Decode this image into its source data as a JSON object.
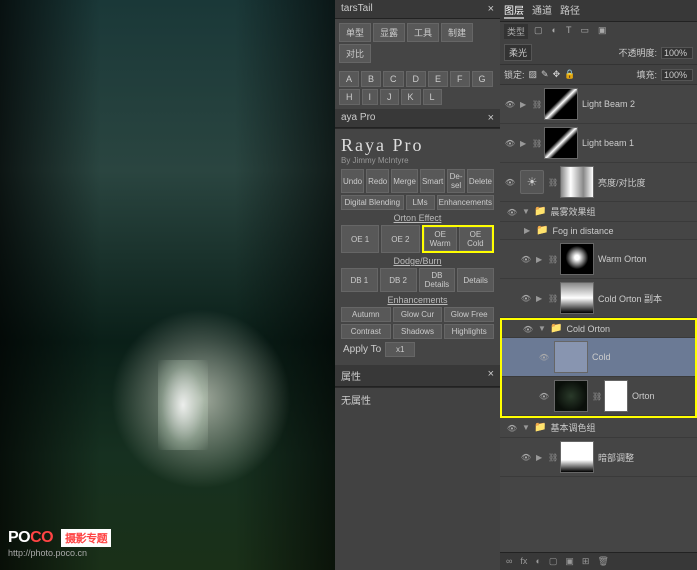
{
  "watermark": {
    "logo_prefix": "PO",
    "logo_suffix": "CO",
    "logo_cn": "摄影专题",
    "url": "http://photo.poco.cn"
  },
  "starstail": {
    "title": "tarsTail",
    "buttons": [
      "单型",
      "显露",
      "工具",
      "制建",
      "对比"
    ],
    "smallbtns": [
      "A",
      "B",
      "C",
      "D",
      "E",
      "F",
      "G",
      "H",
      "I",
      "J",
      "K",
      "L"
    ]
  },
  "raya": {
    "title": "Raya Pro",
    "subtitle": "By Jimmy McIntyre",
    "hdr": "aya Pro",
    "row1": [
      "Undo",
      "Redo",
      "Merge",
      "Smart",
      "De-sel",
      "Delete"
    ],
    "row2": [
      "Digital Blending",
      "LMs",
      "Enhancements"
    ],
    "orton_label": "Orton Effect",
    "orton": [
      "OE 1",
      "OE 2",
      "OE Warm",
      "OE Cold"
    ],
    "dodge_label": "Dodge/Burn",
    "dodge": [
      "DB 1",
      "DB 2",
      "DB Details",
      "Details"
    ],
    "enh_label": "Enhancements",
    "enh1": [
      "Autumn",
      "Glow Cur",
      "Glow Free"
    ],
    "enh2": [
      "Contrast",
      "Shadows",
      "Highlights"
    ],
    "apply": "Apply To",
    "apply_val": "x1"
  },
  "attrib": {
    "tab": "属性",
    "text": "无属性"
  },
  "layers_panel": {
    "tabs": [
      "图层",
      "通道",
      "路径"
    ],
    "kind": "类型",
    "blend": "柔光",
    "opacity_lbl": "不透明度:",
    "opacity": "100%",
    "lock_lbl": "锁定:",
    "fill_lbl": "填充:",
    "fill": "100%"
  },
  "layers": {
    "l1": "Light Beam 2",
    "l2": "Light beam 1",
    "l3": "亮度/对比度",
    "g1": "晨雾效果组",
    "fog": "Fog in distance",
    "l4": "Warm Orton",
    "l5": "Cold Orton 副本",
    "g2": "Cold Orton",
    "l6": "Cold",
    "l7": "Orton",
    "g3": "基本调色组",
    "l8": "暗部调整"
  },
  "footer": {
    "icons": [
      "∞",
      "fx",
      "◐",
      "▢",
      "▣",
      "⊞",
      "🗑"
    ]
  }
}
